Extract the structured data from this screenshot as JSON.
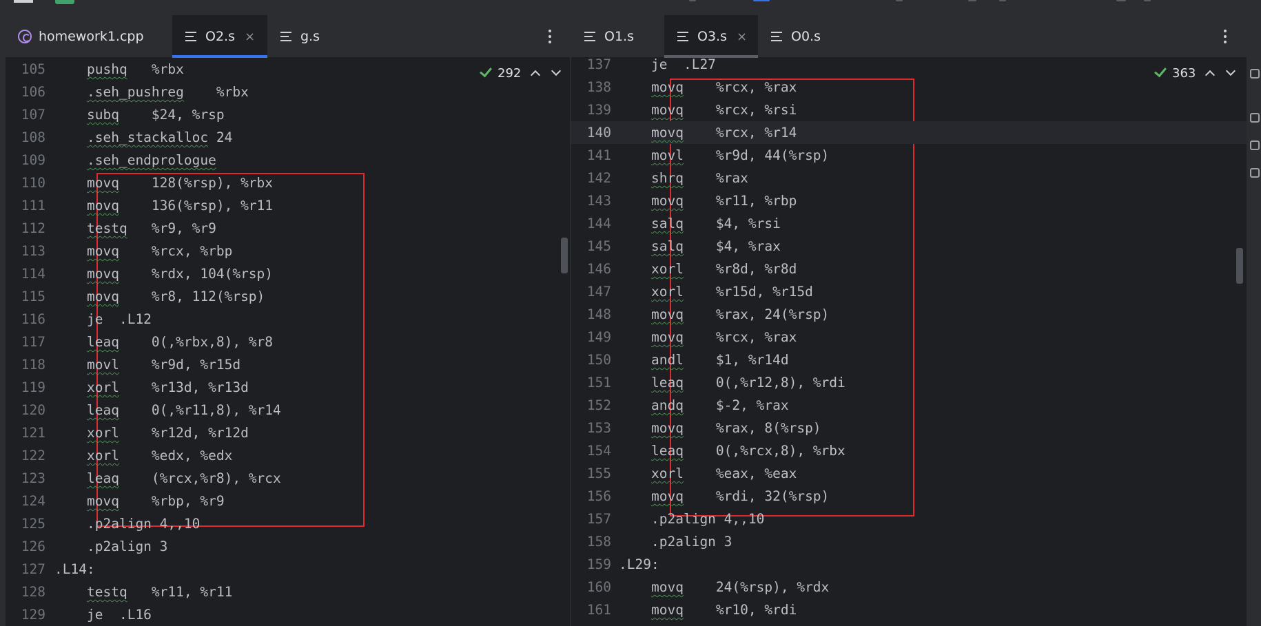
{
  "colors": {
    "editor_bg": "#1e1f22",
    "tab_bar_bg": "#2b2d30",
    "active_tab_indicator": "#3574f0",
    "annotation_box": "#e02a2f",
    "check_green": "#5fb865"
  },
  "left_pane": {
    "tabs": [
      {
        "label": "homework1.cpp",
        "icon": "cpp-file-icon",
        "active": false
      },
      {
        "label": "O2.s",
        "icon": "asm-file-icon",
        "active": true,
        "close": "×"
      },
      {
        "label": "g.s",
        "icon": "asm-file-icon",
        "active": false
      }
    ],
    "inspections_count": "292",
    "lines": [
      {
        "n": "105",
        "code": "pushq   %rbx",
        "ul": "pushq"
      },
      {
        "n": "106",
        "code": ".seh_pushreg    %rbx",
        "ul": ".seh_pushreg"
      },
      {
        "n": "107",
        "code": "subq    $24, %rsp",
        "ul": "subq"
      },
      {
        "n": "108",
        "code": ".seh_stackalloc 24",
        "ul": ".seh_stackalloc"
      },
      {
        "n": "109",
        "code": ".seh_endprologue",
        "ul": ".seh_endprologue"
      },
      {
        "n": "110",
        "code": "movq    128(%rsp), %rbx",
        "ul": "movq"
      },
      {
        "n": "111",
        "code": "movq    136(%rsp), %r11",
        "ul": "movq"
      },
      {
        "n": "112",
        "code": "testq   %r9, %r9",
        "ul": "testq"
      },
      {
        "n": "113",
        "code": "movq    %rcx, %rbp",
        "ul": "movq"
      },
      {
        "n": "114",
        "code": "movq    %rdx, 104(%rsp)",
        "ul": "movq"
      },
      {
        "n": "115",
        "code": "movq    %r8, 112(%rsp)",
        "ul": "movq"
      },
      {
        "n": "116",
        "code": "je  .L12",
        "ul": ""
      },
      {
        "n": "117",
        "code": "leaq    0(,%rbx,8), %r8",
        "ul": "leaq"
      },
      {
        "n": "118",
        "code": "movl    %r9d, %r15d",
        "ul": "movl"
      },
      {
        "n": "119",
        "code": "xorl    %r13d, %r13d",
        "ul": "xorl"
      },
      {
        "n": "120",
        "code": "leaq    0(,%r11,8), %r14",
        "ul": "leaq"
      },
      {
        "n": "121",
        "code": "xorl    %r12d, %r12d",
        "ul": "xorl"
      },
      {
        "n": "122",
        "code": "xorl    %edx, %edx",
        "ul": "xorl"
      },
      {
        "n": "123",
        "code": "leaq    (%rcx,%r8), %rcx",
        "ul": "leaq"
      },
      {
        "n": "124",
        "code": "movq    %rbp, %r9",
        "ul": "movq"
      },
      {
        "n": "125",
        "code": ".p2align 4,,10",
        "ul": ""
      },
      {
        "n": "126",
        "code": ".p2align 3",
        "ul": ""
      },
      {
        "n": "127",
        "code": ".L14:",
        "ul": "",
        "label": true
      },
      {
        "n": "128",
        "code": "testq   %r11, %r11",
        "ul": "testq"
      },
      {
        "n": "129",
        "code": "je  .L16",
        "ul": ""
      }
    ]
  },
  "right_pane": {
    "tabs": [
      {
        "label": "O1.s",
        "icon": "asm-file-icon",
        "active": false
      },
      {
        "label": "O3.s",
        "icon": "asm-file-icon",
        "active": true,
        "close": "×"
      },
      {
        "label": "O0.s",
        "icon": "asm-file-icon",
        "active": false
      }
    ],
    "inspections_count": "363",
    "lines": [
      {
        "n": "137",
        "code": "je  .L27",
        "ul": ""
      },
      {
        "n": "138",
        "code": "movq    %rcx, %rax",
        "ul": "movq"
      },
      {
        "n": "139",
        "code": "movq    %rcx, %rsi",
        "ul": "movq"
      },
      {
        "n": "140",
        "code": "movq    %rcx, %r14",
        "ul": "movq",
        "current": true
      },
      {
        "n": "141",
        "code": "movl    %r9d, 44(%rsp)",
        "ul": "movl"
      },
      {
        "n": "142",
        "code": "shrq    %rax",
        "ul": "shrq"
      },
      {
        "n": "143",
        "code": "movq    %r11, %rbp",
        "ul": "movq"
      },
      {
        "n": "144",
        "code": "salq    $4, %rsi",
        "ul": "salq"
      },
      {
        "n": "145",
        "code": "salq    $4, %rax",
        "ul": "salq"
      },
      {
        "n": "146",
        "code": "xorl    %r8d, %r8d",
        "ul": "xorl"
      },
      {
        "n": "147",
        "code": "xorl    %r15d, %r15d",
        "ul": "xorl"
      },
      {
        "n": "148",
        "code": "movq    %rax, 24(%rsp)",
        "ul": "movq"
      },
      {
        "n": "149",
        "code": "movq    %rcx, %rax",
        "ul": "movq"
      },
      {
        "n": "150",
        "code": "andl    $1, %r14d",
        "ul": "andl"
      },
      {
        "n": "151",
        "code": "leaq    0(,%r12,8), %rdi",
        "ul": "leaq"
      },
      {
        "n": "152",
        "code": "andq    $-2, %rax",
        "ul": "andq"
      },
      {
        "n": "153",
        "code": "movq    %rax, 8(%rsp)",
        "ul": "movq"
      },
      {
        "n": "154",
        "code": "leaq    0(,%rcx,8), %rbx",
        "ul": "leaq"
      },
      {
        "n": "155",
        "code": "xorl    %eax, %eax",
        "ul": "xorl"
      },
      {
        "n": "156",
        "code": "movq    %rdi, 32(%rsp)",
        "ul": "movq"
      },
      {
        "n": "157",
        "code": ".p2align 4,,10",
        "ul": ""
      },
      {
        "n": "158",
        "code": ".p2align 3",
        "ul": ""
      },
      {
        "n": "159",
        "code": ".L29:",
        "ul": "",
        "label": true
      },
      {
        "n": "160",
        "code": "movq    24(%rsp), %rdx",
        "ul": "movq"
      },
      {
        "n": "161",
        "code": "movq    %r10, %rdi",
        "ul": "movq"
      }
    ]
  }
}
